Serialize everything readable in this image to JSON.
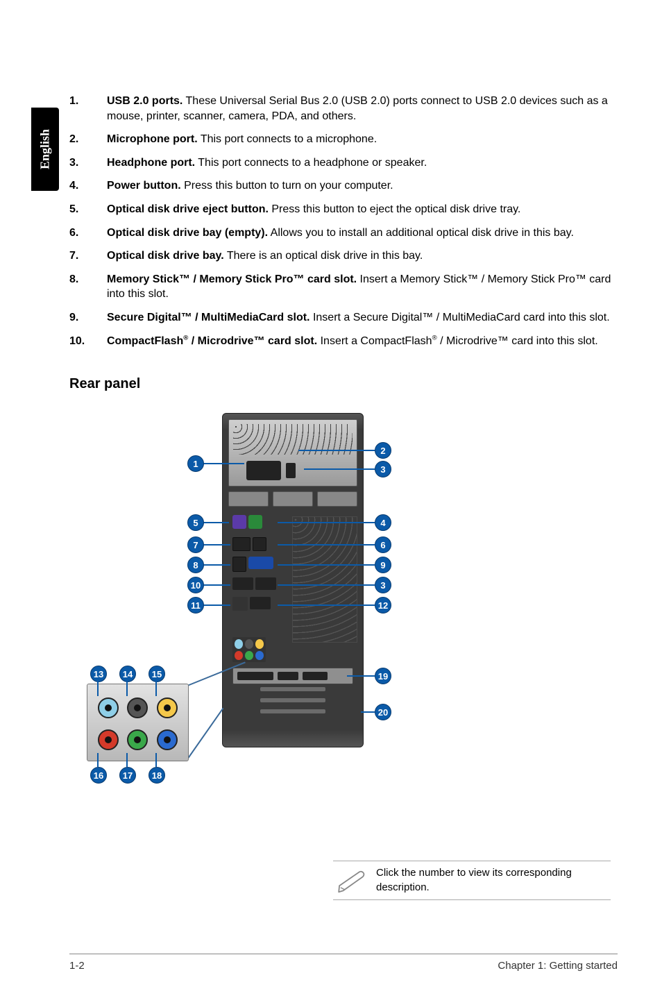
{
  "lang_tab": "English",
  "front_list": [
    {
      "num": "1.",
      "lead": "USB 2.0 ports.",
      "text": " These Universal Serial Bus 2.0 (USB 2.0) ports connect to USB 2.0 devices such as a mouse, printer, scanner, camera, PDA, and others."
    },
    {
      "num": "2.",
      "lead": "Microphone port.",
      "text": " This port connects to a microphone."
    },
    {
      "num": "3.",
      "lead": "Headphone port.",
      "text": " This port connects to a headphone or speaker."
    },
    {
      "num": "4.",
      "lead": "Power button.",
      "text": " Press this button to turn on your computer."
    },
    {
      "num": "5.",
      "lead": "Optical disk drive eject button.",
      "text": " Press this button to eject the optical disk drive tray."
    },
    {
      "num": "6.",
      "lead": "Optical disk drive bay (empty).",
      "text": " Allows you to install an additional optical disk drive in this bay."
    },
    {
      "num": "7.",
      "lead": "Optical disk drive bay.",
      "text": " There is an optical disk drive in this bay."
    },
    {
      "num": "8.",
      "lead": "Memory Stick™ / Memory Stick Pro™ card slot.",
      "text": " Insert a Memory Stick™ / Memory Stick Pro™ card into this slot."
    },
    {
      "num": "9.",
      "lead": "Secure Digital™ / MultiMediaCard slot.",
      "text": " Insert a Secure Digital™ / MultiMediaCard card into this slot."
    },
    {
      "num": "10.",
      "lead_html": "CompactFlash<sup>®</sup> / Microdrive™ card slot.",
      "text_html": " Insert a CompactFlash<sup>®</sup> / Microdrive™ card into this slot."
    }
  ],
  "rear_heading": "Rear panel",
  "callouts": {
    "c1": "1",
    "c2": "2",
    "c3": "3",
    "c4": "4",
    "c5": "5",
    "c6": "6",
    "c7": "7",
    "c8": "8",
    "c9": "9",
    "c10": "10",
    "c11": "11",
    "c12": "12",
    "c13": "13",
    "c14": "14",
    "c15": "15",
    "c16": "16",
    "c17": "17",
    "c18": "18",
    "c19": "19",
    "c20": "20"
  },
  "note_text": "Click the number to view its corresponding description.",
  "footer_left": "1-2",
  "footer_right": "Chapter 1: Getting started"
}
